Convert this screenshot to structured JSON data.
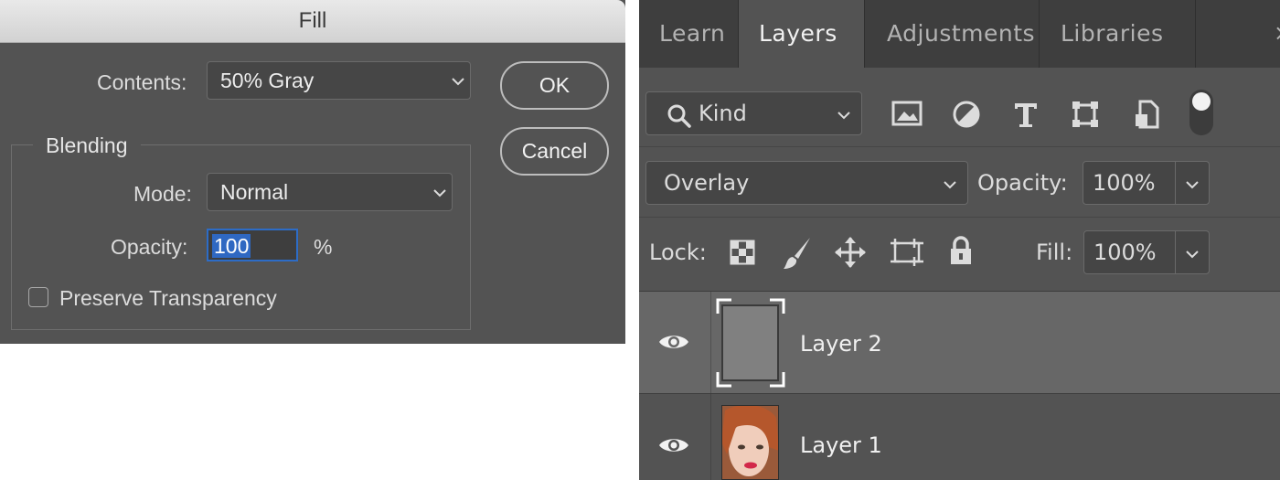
{
  "fill_dialog": {
    "title": "Fill",
    "contents_label": "Contents:",
    "contents_value": "50% Gray",
    "ok_label": "OK",
    "cancel_label": "Cancel",
    "blending_label": "Blending",
    "mode_label": "Mode:",
    "mode_value": "Normal",
    "opacity_label": "Opacity:",
    "opacity_value": "100",
    "opacity_unit": "%",
    "preserve_transparency_label": "Preserve Transparency",
    "preserve_transparency_checked": false
  },
  "layers_panel": {
    "tabs": [
      {
        "label": "Learn",
        "active": false
      },
      {
        "label": "Layers",
        "active": true
      },
      {
        "label": "Adjustments",
        "active": false
      },
      {
        "label": "Libraries",
        "active": false
      }
    ],
    "close_glyph": "×",
    "filter_kind_value": "Kind",
    "filter_icons": [
      "image-filter-icon",
      "adjustment-filter-icon",
      "type-filter-icon",
      "shape-filter-icon",
      "smart-object-filter-icon",
      "filter-toggle-icon"
    ],
    "blend_mode_value": "Overlay",
    "opacity_label": "Opacity:",
    "opacity_value": "100%",
    "lock_label": "Lock:",
    "lock_icons": [
      "lock-transparent-pixels-icon",
      "lock-image-pixels-icon",
      "lock-position-icon",
      "lock-artboard-icon",
      "lock-all-icon"
    ],
    "fill_label": "Fill:",
    "fill_value": "100%",
    "layers": [
      {
        "name": "Layer 2",
        "visible": true,
        "selected": true,
        "thumbnail": "gray-fill"
      },
      {
        "name": "Layer 1",
        "visible": true,
        "selected": false,
        "thumbnail": "portrait-photo"
      }
    ]
  },
  "colors": {
    "panel_bg": "#535353",
    "selected_row": "#676767",
    "accent_blue": "#2f68c2",
    "gray_fill": "#808080"
  }
}
